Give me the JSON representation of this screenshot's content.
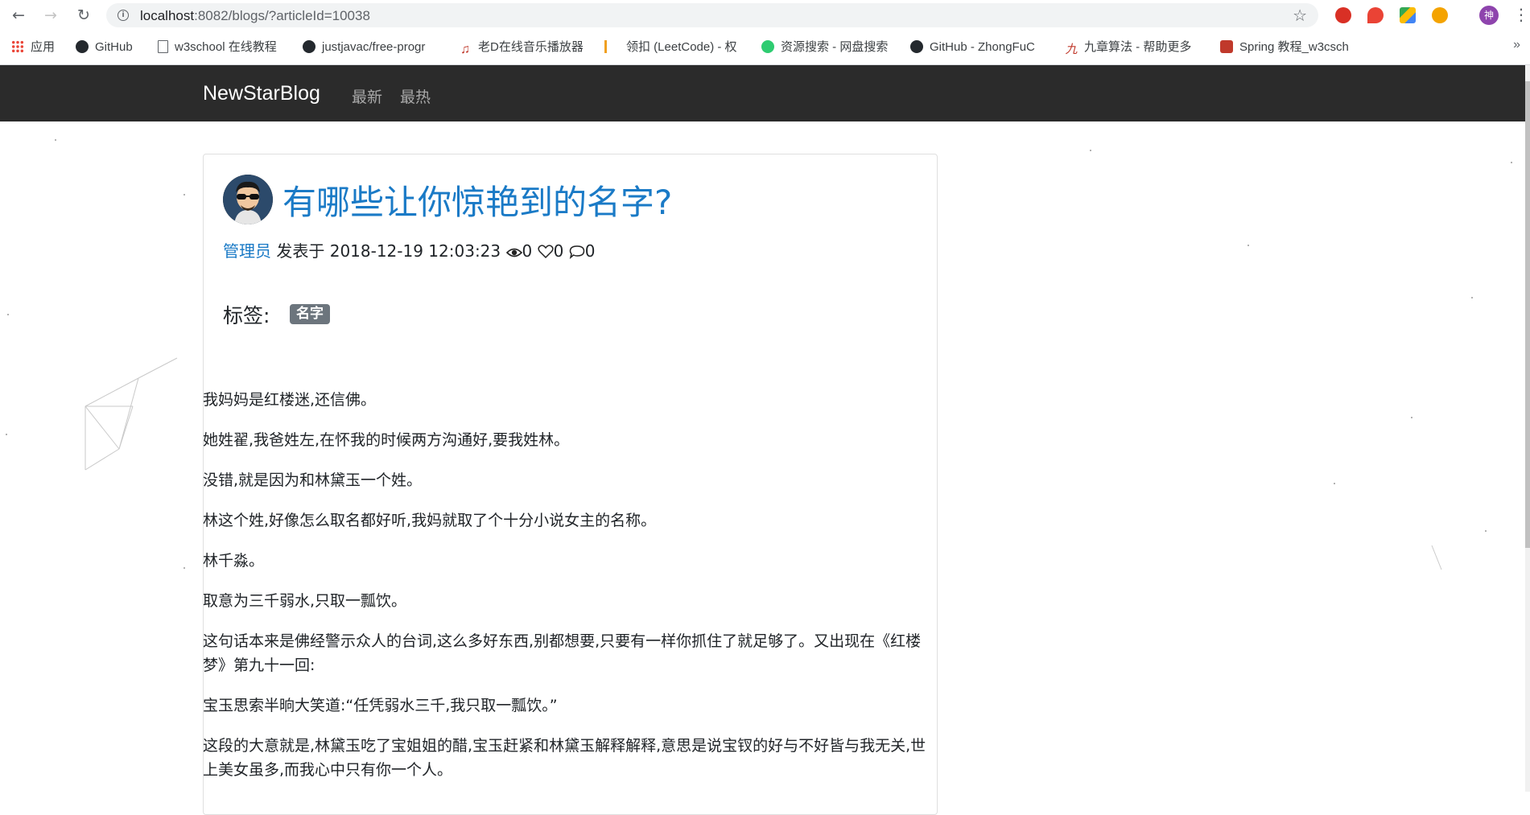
{
  "browser": {
    "url_host": "localhost",
    "url_path": ":8082/blogs/?articleId=10038",
    "profile_initial": "神",
    "bookmarks": [
      {
        "label": "应用",
        "icon": "apps-grid-icon"
      },
      {
        "label": "GitHub",
        "icon": "github-icon"
      },
      {
        "label": "w3school 在线教程",
        "icon": "page-icon"
      },
      {
        "label": "justjavac/free-progr",
        "icon": "github-icon"
      },
      {
        "label": "老D在线音乐播放器",
        "icon": "music-icon"
      },
      {
        "label": "领扣 (LeetCode) - 权",
        "icon": "leetcode-icon"
      },
      {
        "label": "资源搜索 - 网盘搜索",
        "icon": "search-resource-icon"
      },
      {
        "label": "GitHub - ZhongFuC",
        "icon": "github-icon"
      },
      {
        "label": "九章算法 - 帮助更多",
        "icon": "jiuzhang-icon"
      },
      {
        "label": "Spring 教程_w3csch",
        "icon": "w3c-icon"
      }
    ]
  },
  "navbar": {
    "brand": "NewStarBlog",
    "links": [
      "最新",
      "最热"
    ]
  },
  "article": {
    "title": "有哪些让你惊艳到的名字?",
    "author": "管理员",
    "published_prefix": "发表于",
    "published_at": "2018-12-19 12:03:23",
    "views": "0",
    "likes": "0",
    "comments": "0",
    "tags_label": "标签:",
    "tags": [
      "名字"
    ],
    "paragraphs": [
      "我妈妈是红楼迷,还信佛。",
      "她姓翟,我爸姓左,在怀我的时候两方沟通好,要我姓林。",
      "没错,就是因为和林黛玉一个姓。",
      "林这个姓,好像怎么取名都好听,我妈就取了个十分小说女主的名称。",
      "林千淼。",
      "取意为三千弱水,只取一瓢饮。",
      "这句话本来是佛经警示众人的台词,这么多好东西,别都想要,只要有一样你抓住了就足够了。又出现在《红楼梦》第九十一回:",
      "宝玉思索半晌大笑道:“任凭弱水三千,我只取一瓢饮。”",
      "这段的大意就是,林黛玉吃了宝姐姐的醋,宝玉赶紧和林黛玉解释解释,意思是说宝钗的好与不好皆与我无关,世上美女虽多,而我心中只有你一个人。"
    ]
  },
  "colors": {
    "navbar_bg": "#2b2b2b",
    "link_blue": "#1a7ac6",
    "badge_gray": "#6c757d"
  }
}
